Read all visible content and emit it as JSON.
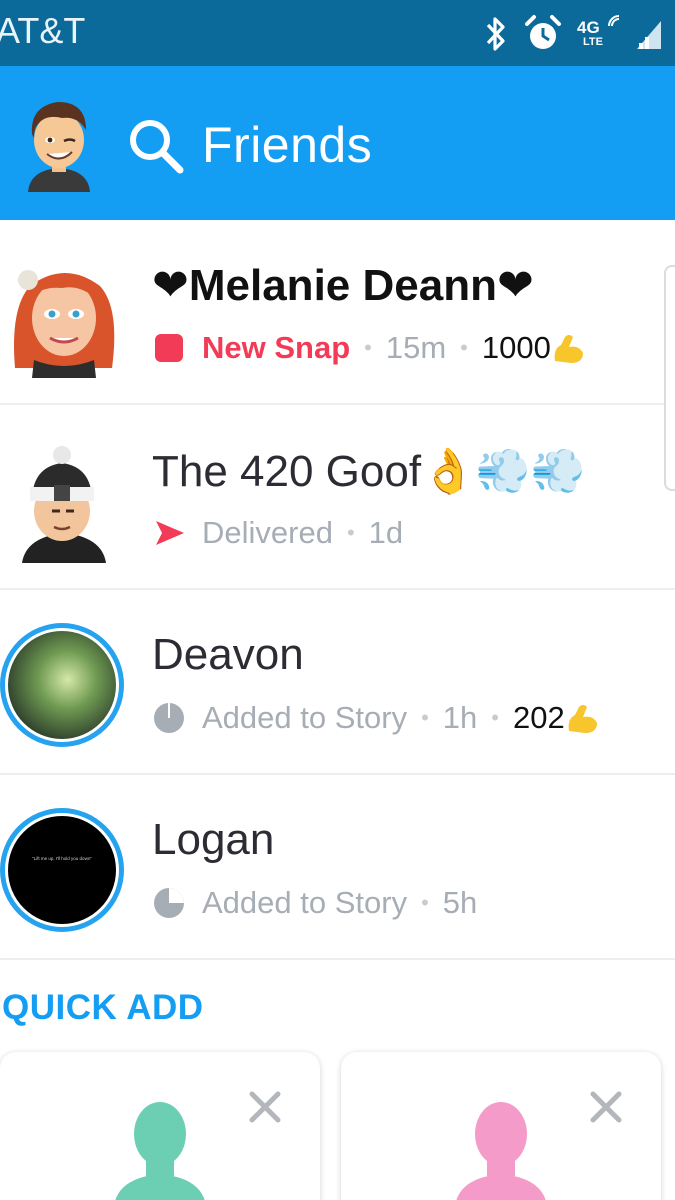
{
  "status_bar": {
    "carrier": "AT&T",
    "icons": [
      "bluetooth-icon",
      "alarm-icon",
      "4g-lte-icon",
      "signal-icon"
    ],
    "network_label": "4G",
    "network_sub": "LTE"
  },
  "header": {
    "title": "Friends",
    "search_icon": "search-icon",
    "avatar": "bitmoji-avatar"
  },
  "friends": [
    {
      "name": "❤Melanie Deann❤",
      "bold": true,
      "status_icon": "filled-square-icon",
      "status": "New Snap",
      "time": "15m",
      "streak": "1000",
      "streak_icon": "flexed-biceps-emoji"
    },
    {
      "name": "The 420 Goof👌💨💨",
      "bold": false,
      "status_icon": "sent-arrow-icon",
      "status": "Delivered",
      "time": "1d"
    },
    {
      "name": "Deavon",
      "bold": false,
      "status_icon": "story-progress-icon",
      "status": "Added to Story",
      "time": "1h",
      "streak": "202",
      "streak_icon": "flexed-biceps-emoji"
    },
    {
      "name": "Logan",
      "bold": false,
      "status_icon": "story-progress-icon",
      "status": "Added to Story",
      "time": "5h",
      "story_text": "\"Lift me up, I'll hold you down\""
    }
  ],
  "quick_add": {
    "title": "QUICK ADD",
    "cards": [
      {
        "silhouette_color": "#6ccfb4",
        "dismiss_icon": "close-icon"
      },
      {
        "silhouette_color": "#f59bc9",
        "dismiss_icon": "close-icon"
      }
    ]
  },
  "colors": {
    "header": "#139df3",
    "status_bar": "#0b6a99",
    "new_snap": "#f23c57",
    "story_ring": "#26a3ee"
  }
}
